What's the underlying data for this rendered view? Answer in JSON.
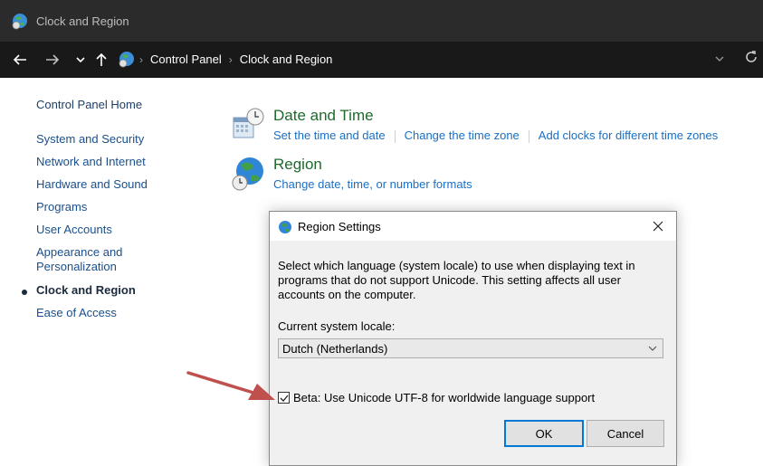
{
  "window": {
    "title": "Clock and Region"
  },
  "address_bar": {
    "crumbs": [
      "Control Panel",
      "Clock and Region"
    ]
  },
  "left_nav": {
    "home": "Control Panel Home",
    "items": [
      "System and Security",
      "Network and Internet",
      "Hardware and Sound",
      "Programs",
      "User Accounts",
      "Appearance and Personalization",
      "Clock and Region",
      "Ease of Access"
    ],
    "current": "Clock and Region"
  },
  "categories": [
    {
      "title": "Date and Time",
      "links": [
        "Set the time and date",
        "Change the time zone",
        "Add clocks for different time zones"
      ]
    },
    {
      "title": "Region",
      "links": [
        "Change date, time, or number formats"
      ]
    }
  ],
  "dialog": {
    "title": "Region Settings",
    "description": "Select which language (system locale) to use when displaying text in programs that do not support Unicode. This setting affects all user accounts on the computer.",
    "locale_label": "Current system locale:",
    "locale_value": "Dutch (Netherlands)",
    "checkbox_label": "Beta: Use Unicode UTF-8 for worldwide language support",
    "checkbox_checked": true,
    "ok_label": "OK",
    "cancel_label": "Cancel"
  },
  "colors": {
    "title_bar": "#2b2b2b",
    "address_bar": "#191919",
    "link": "#1a6fc4",
    "category_title": "#1d6a2c",
    "annotation_arrow": "#c0504d"
  }
}
